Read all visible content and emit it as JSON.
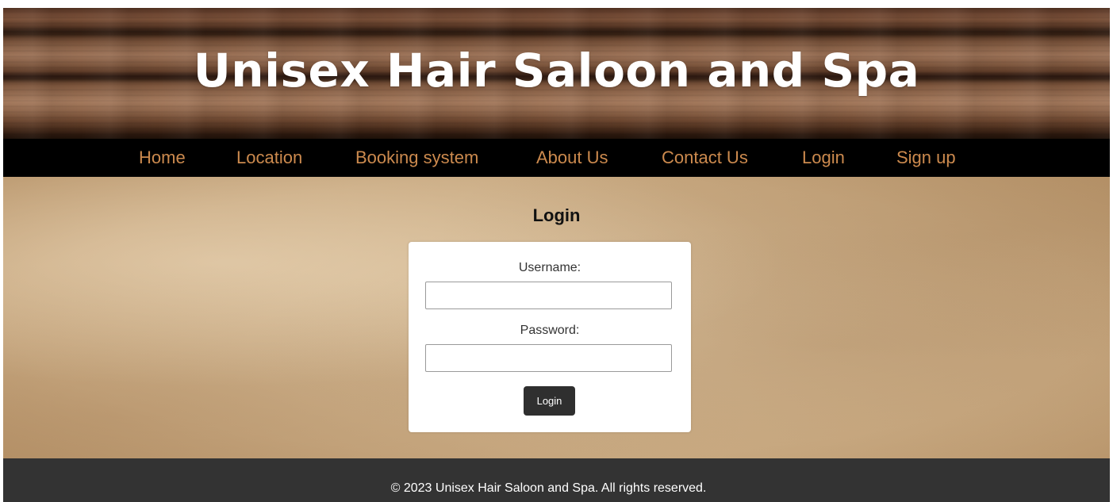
{
  "header": {
    "title": "Unisex Hair Saloon and Spa"
  },
  "nav": {
    "items": [
      {
        "label": "Home"
      },
      {
        "label": "Location"
      },
      {
        "label": "Booking system"
      },
      {
        "label": "About Us"
      },
      {
        "label": "Contact Us"
      },
      {
        "label": "Login"
      },
      {
        "label": "Sign up"
      }
    ],
    "link_color": "#cc8a4e"
  },
  "main": {
    "heading": "Login",
    "form": {
      "username_label": "Username:",
      "username_value": "",
      "password_label": "Password:",
      "password_value": "",
      "submit_label": "Login"
    }
  },
  "footer": {
    "text": "© 2023 Unisex Hair Saloon and Spa. All rights reserved."
  },
  "colors": {
    "nav_background": "#000000",
    "footer_background": "#333333",
    "button_background": "#2f2f2f"
  }
}
